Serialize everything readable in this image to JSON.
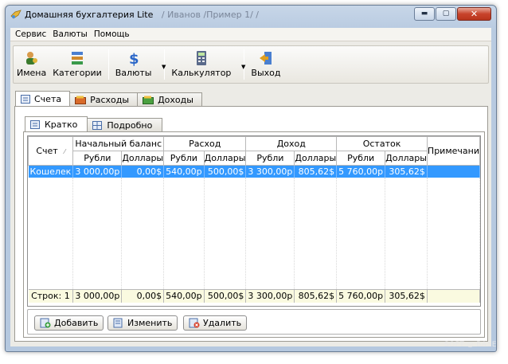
{
  "window": {
    "title": "Домашняя бухгалтерия Lite",
    "path": "/ Иванов /Пример 1/ /",
    "buttons": [
      "minimize",
      "maximize",
      "close"
    ]
  },
  "menu": [
    "Сервис",
    "Валюты",
    "Помощь"
  ],
  "toolbar": [
    {
      "label": "Имена",
      "icon": "names-icon",
      "dropdown": false
    },
    {
      "label": "Категории",
      "icon": "categories-icon",
      "dropdown": false
    },
    {
      "label": "Валюты",
      "icon": "currency-icon",
      "dropdown": true
    },
    {
      "label": "Калькулятор",
      "icon": "calculator-icon",
      "dropdown": true
    },
    {
      "label": "Выход",
      "icon": "exit-icon",
      "dropdown": false
    }
  ],
  "tabs": [
    {
      "label": "Счета",
      "active": true
    },
    {
      "label": "Расходы",
      "active": false
    },
    {
      "label": "Доходы",
      "active": false
    }
  ],
  "subtabs": [
    {
      "label": "Кратко",
      "active": true
    },
    {
      "label": "Подробно",
      "active": false
    }
  ],
  "grid": {
    "account_header": "Счет",
    "groups": [
      "Начальный баланс",
      "Расход",
      "Доход",
      "Остаток"
    ],
    "subcols": [
      "Рубли",
      "Доллары"
    ],
    "note_header": "Примечани",
    "rows": [
      {
        "account": "Кошелек",
        "values": [
          "3 000,00р",
          "0,00$",
          "540,00р",
          "500,00$",
          "3 300,00р",
          "805,62$",
          "5 760,00р",
          "305,62$"
        ],
        "note": ""
      }
    ],
    "total": {
      "label": "Строк: 1",
      "values": [
        "3 000,00р",
        "0,00$",
        "540,00р",
        "500,00$",
        "3 300,00р",
        "805,62$",
        "5 760,00р",
        "305,62$"
      ]
    }
  },
  "actions": {
    "add": "Добавить",
    "edit": "Изменить",
    "delete": "Удалить"
  },
  "watermark": "SOFT ◎ BASE",
  "colors": {
    "selection": "#3399ff",
    "total_row": "#fafae0"
  }
}
